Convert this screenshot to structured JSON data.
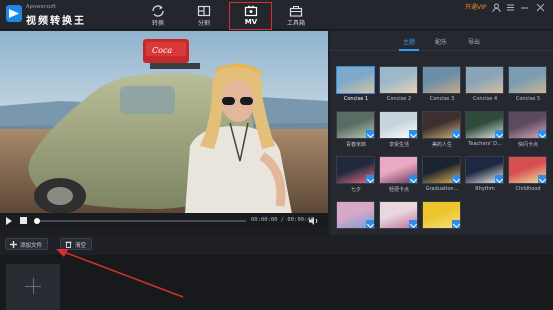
{
  "app": {
    "brand_small": "Apowersoft",
    "brand_title": "视频转换王",
    "vip_label": "开通VIP"
  },
  "nav": [
    {
      "label": "转换",
      "icon": "refresh-icon",
      "active": false
    },
    {
      "label": "分割",
      "icon": "split-icon",
      "active": false
    },
    {
      "label": "MV",
      "icon": "mv-icon",
      "active": true
    },
    {
      "label": "工具箱",
      "icon": "toolbox-icon",
      "active": false
    }
  ],
  "player": {
    "time_display": "00:00:00 / 00:00:40",
    "progress": 0.0
  },
  "panel": {
    "tabs": [
      {
        "label": "主题",
        "active": true
      },
      {
        "label": "配乐",
        "active": false
      },
      {
        "label": "导出",
        "active": false
      }
    ],
    "themes": [
      {
        "label": "Concise 1",
        "selected": true,
        "download": false
      },
      {
        "label": "Concise 2",
        "selected": false,
        "download": false
      },
      {
        "label": "Concise 3",
        "selected": false,
        "download": false
      },
      {
        "label": "Concise 4",
        "selected": false,
        "download": false
      },
      {
        "label": "Concise 5",
        "selected": false,
        "download": false
      },
      {
        "label": "青春米郎",
        "selected": false,
        "download": true
      },
      {
        "label": "享受生活",
        "selected": false,
        "download": true
      },
      {
        "label": "美的人生",
        "selected": false,
        "download": true
      },
      {
        "label": "Teachers' D...",
        "selected": false,
        "download": true
      },
      {
        "label": "快闪卡点",
        "selected": false,
        "download": true
      },
      {
        "label": "七夕",
        "selected": false,
        "download": true
      },
      {
        "label": "轻便卡点",
        "selected": false,
        "download": true
      },
      {
        "label": "Graduation...",
        "selected": false,
        "download": true
      },
      {
        "label": "Rhythm",
        "selected": false,
        "download": true
      },
      {
        "label": "Childhood",
        "selected": false,
        "download": true
      },
      {
        "label": "",
        "selected": false,
        "download": true
      },
      {
        "label": "",
        "selected": false,
        "download": true
      },
      {
        "label": "",
        "selected": false,
        "download": true
      }
    ]
  },
  "toolbar": {
    "add_file_label": "添加文件",
    "clear_label": "清空"
  },
  "colors": {
    "accent": "#2f8de4",
    "highlight_box": "#d8302c",
    "vip": "#f08a24"
  }
}
